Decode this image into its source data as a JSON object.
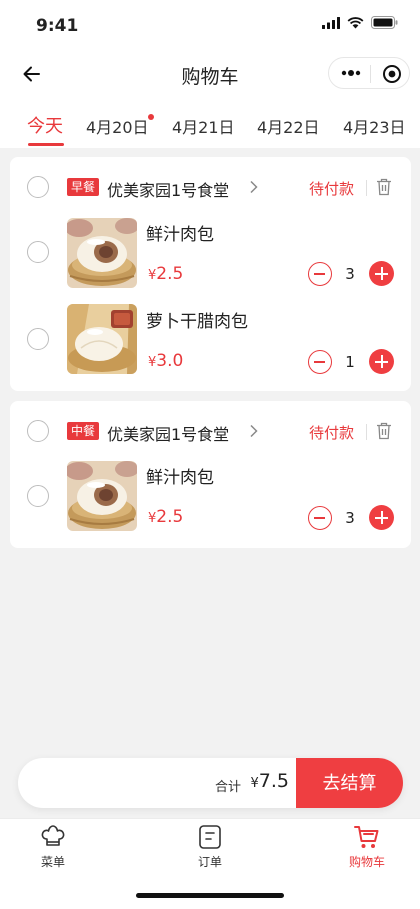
{
  "status_bar": {
    "time": "9:41"
  },
  "nav": {
    "title": "购物车"
  },
  "date_tabs": [
    {
      "label": "今天",
      "active": true
    },
    {
      "label": "4月20日",
      "dot": true
    },
    {
      "label": "4月21日"
    },
    {
      "label": "4月22日"
    },
    {
      "label": "4月23日"
    }
  ],
  "orders": [
    {
      "meal": "早餐",
      "canteen": "优美家园1号食堂",
      "status": "待付款",
      "items": [
        {
          "name": "鲜汁肉包",
          "currency": "¥",
          "price": "2.5",
          "qty": "3"
        },
        {
          "name": "萝卜干腊肉包",
          "currency": "¥",
          "price": "3.0",
          "qty": "1"
        }
      ]
    },
    {
      "meal": "中餐",
      "canteen": "优美家园1号食堂",
      "status": "待付款",
      "items": [
        {
          "name": "鲜汁肉包",
          "currency": "¥",
          "price": "2.5",
          "qty": "3"
        }
      ]
    }
  ],
  "checkout": {
    "total_label": "合计",
    "currency": "¥",
    "total": "7.5",
    "button": "去结算"
  },
  "tabbar": [
    {
      "label": "菜单",
      "icon": "chef-hat-icon"
    },
    {
      "label": "订单",
      "icon": "order-doc-icon"
    },
    {
      "label": "购物车",
      "icon": "cart-icon",
      "active": true
    }
  ],
  "colors": {
    "accent": "#e8393c",
    "background": "#f2f2f2"
  }
}
